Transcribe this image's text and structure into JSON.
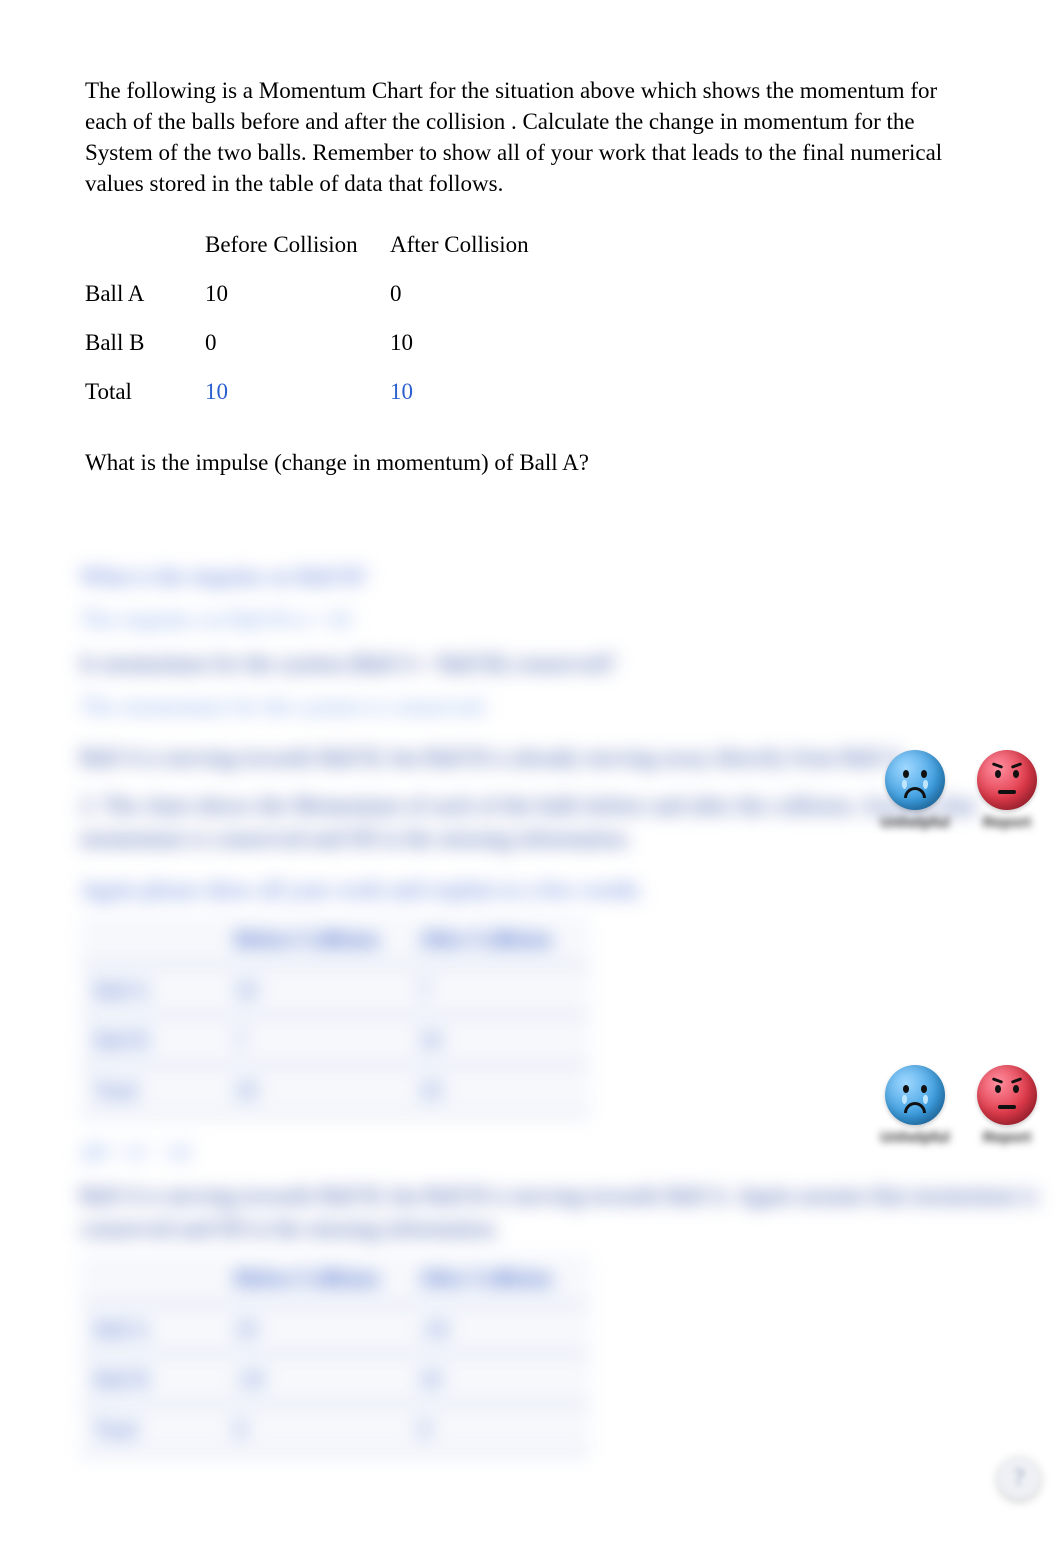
{
  "intro": "The following is a  Momentum Chart    for the situation above     which shows the momentum for each of the balls before and after the collision    .  Calculate the change in momentum for the System of the two balls.       Remember to show all of your work that leads to the final numerical values stored in the table of data that follows.",
  "table": {
    "headers": {
      "col1": "",
      "col2": "Before Collision",
      "col3": "After Collision"
    },
    "rows": [
      {
        "label": "Ball A",
        "before": "10",
        "after": "0",
        "blue": false
      },
      {
        "label": "Ball B",
        "before": "0",
        "after": "10",
        "blue": false
      },
      {
        "label": "Total",
        "before": "10",
        "after": "10",
        "blue": true
      }
    ]
  },
  "question": "What is the impulse (change in momentum) of Ball A?",
  "obscured": {
    "line1": "What is the impulse on Ball B?",
    "line2": "The impulse on Ball B is +10",
    "line3": "Is momentum for the system (Ball A + Ball B) conserved?",
    "line4": "The momentum for the system is conserved.",
    "line5": "Ball A is moving towards Ball B, but Ball B is already moving away directly from Ball A.",
    "line6": "2.  The chart shows the Momentum of each of the balls before and after the collision.  Assume that momentum is conserved and fill in the missing information.",
    "line7": "Again please show all your work and explain in a few words.",
    "line8": "ΔP = 0 − 10",
    "line9": "Ball A is moving towards Ball B, but Ball B is moving towards Ball A.  Again assume that momentum is conserved and fill in the missing information.",
    "table2": {
      "h1": "",
      "h2": "Before Collision",
      "h3": "After Collision",
      "r1c1": "Ball A",
      "r1c2": "10",
      "r1c3": "?",
      "r2c1": "Ball B",
      "r2c2": "?",
      "r2c3": "10",
      "r3c1": "Total",
      "r3c2": "10",
      "r3c3": "10"
    },
    "table3": {
      "h1": "",
      "h2": "Before Collision",
      "h3": "After Collision",
      "r1c1": "Ball A",
      "r1c2": "10",
      "r1c3": "-10",
      "r2c1": "Ball B",
      "r2c2": "-10",
      "r2c3": "10",
      "r3c1": "Total",
      "r3c2": "0",
      "r3c3": "0"
    }
  },
  "reactions": {
    "label1": "Unhelpful",
    "label2": "Report",
    "label3": "Unhelpful",
    "label4": "Report"
  },
  "help_glyph": "?"
}
